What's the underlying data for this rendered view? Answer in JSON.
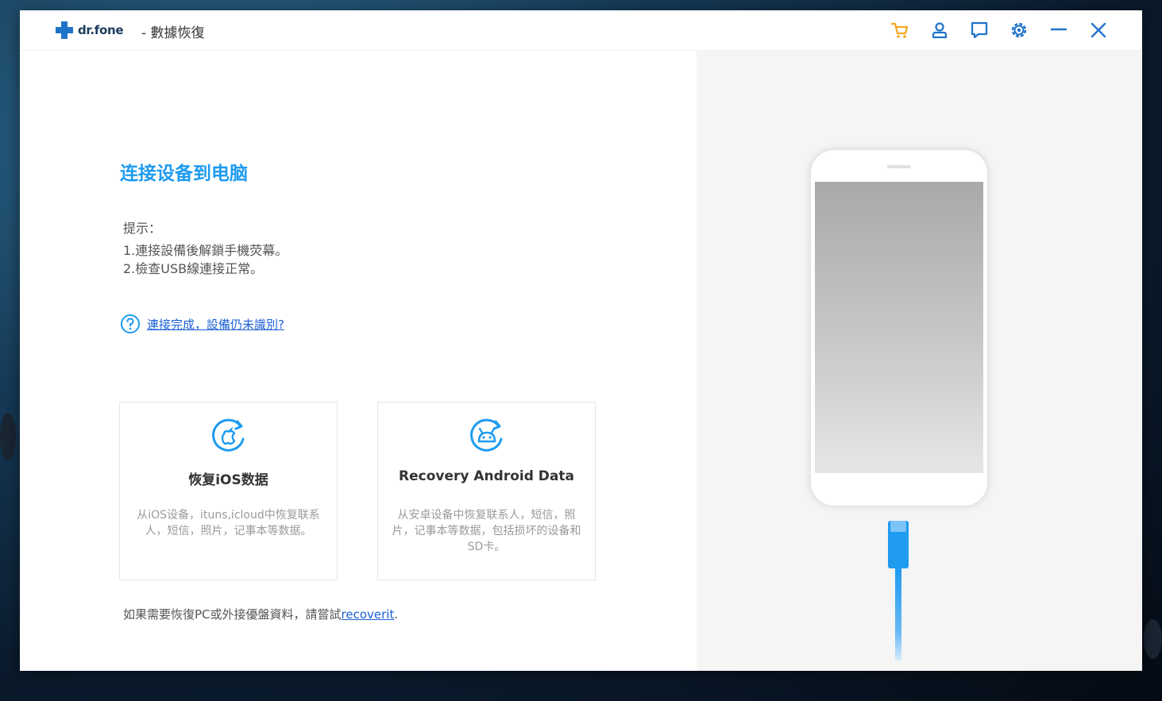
{
  "app": {
    "brand": "dr.fone",
    "module_title": "- 數據恢復",
    "accent_color": "#1e9bf0",
    "cart_color": "#f5a623"
  },
  "toolbar": {
    "icons": [
      "cart-icon",
      "user-icon",
      "feedback-icon",
      "settings-icon",
      "minimize-icon",
      "close-icon"
    ]
  },
  "main": {
    "heading": "连接设备到电脑",
    "tips_title": "提示：",
    "tips": [
      "1.連接設備後解鎖手機荧幕。",
      "2.檢查USB線連接正常。"
    ],
    "help_link": "連接完成，設備仍未識別?",
    "cards": [
      {
        "icon": "ios-recovery-icon",
        "title": "恢复iOS数据",
        "desc": "从iOS设备，ituns,icloud中恢复联系人，短信，照片，记事本等数据。"
      },
      {
        "icon": "android-recovery-icon",
        "title": "Recovery Android Data",
        "desc": "从安卓设备中恢复联系人，短信，照片，记事本等数据，包括损坏的设备和SD卡。"
      }
    ],
    "footer_prefix": "如果需要恢復PC或外接優盤資料，請嘗試",
    "footer_link": "recoverit",
    "footer_suffix": "."
  }
}
